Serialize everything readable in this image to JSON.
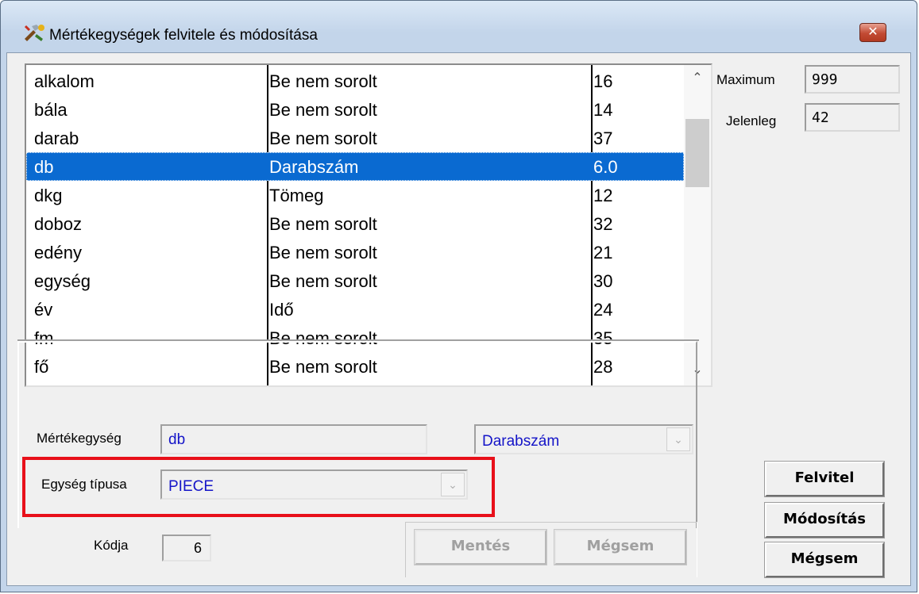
{
  "window": {
    "title": "Mértékegységek felvitele és módosítása",
    "close_label": "✕"
  },
  "list": {
    "rows": [
      {
        "name": "alkalom",
        "type": "Be nem sorolt",
        "code": "16"
      },
      {
        "name": "bála",
        "type": "Be nem sorolt",
        "code": "14"
      },
      {
        "name": "darab",
        "type": "Be nem sorolt",
        "code": "37"
      },
      {
        "name": "db",
        "type": "Darabszám",
        "code": "6.0",
        "selected": true
      },
      {
        "name": "dkg",
        "type": "Tömeg",
        "code": "12"
      },
      {
        "name": "doboz",
        "type": "Be nem sorolt",
        "code": "32"
      },
      {
        "name": "edény",
        "type": "Be nem sorolt",
        "code": "21"
      },
      {
        "name": "egység",
        "type": "Be nem sorolt",
        "code": "30"
      },
      {
        "name": "év",
        "type": "Idő",
        "code": "24"
      },
      {
        "name": "fm",
        "type": "Be nem sorolt",
        "code": "35"
      },
      {
        "name": "fő",
        "type": "Be nem sorolt",
        "code": "28"
      }
    ],
    "scroll_up": "⌃",
    "scroll_down": "⌄"
  },
  "info": {
    "maximum_label": "Maximum",
    "maximum_value": "999",
    "current_label": "Jelenleg",
    "current_value": "42"
  },
  "form": {
    "unit_label": "Mértékegység",
    "unit_value": "db",
    "category_value": "Darabszám",
    "type_label": "Egység típusa",
    "type_value": "PIECE",
    "code_label": "Kódja",
    "code_value": "6",
    "combo_arrow": "⌄"
  },
  "buttons": {
    "save": "Mentés",
    "cancel_edit": "Mégsem",
    "add": "Felvitel",
    "modify": "Módosítás",
    "cancel": "Mégsem"
  },
  "colors": {
    "selection": "#0a6ad1",
    "highlight_frame": "#e8101a",
    "field_text": "#1414c8"
  }
}
